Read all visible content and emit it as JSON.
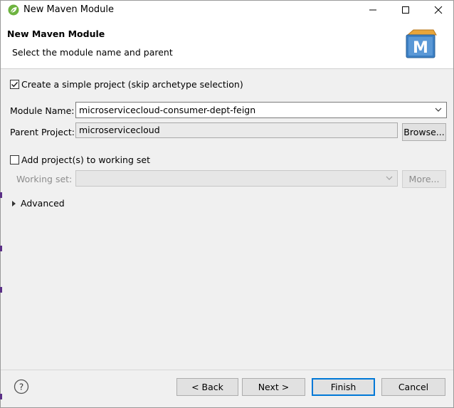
{
  "window": {
    "title": "New Maven Module",
    "minimize_icon": "minimize-icon",
    "maximize_icon": "maximize-icon",
    "close_icon": "close-icon"
  },
  "banner": {
    "title": "New Maven Module",
    "subtitle": "Select the module name and parent",
    "logo_letter": "M"
  },
  "form": {
    "simple_project": {
      "label": "Create a simple project (skip archetype selection)",
      "checked": true
    },
    "module_name": {
      "label": "Module Name:",
      "value": "microservicecloud-consumer-dept-feign"
    },
    "parent_project": {
      "label": "Parent Project:",
      "value": "microservicecloud",
      "browse_label": "Browse..."
    },
    "working_set_toggle": {
      "label": "Add project(s) to working set",
      "checked": false
    },
    "working_set": {
      "label": "Working set:",
      "value": "",
      "more_label": "More..."
    },
    "advanced": {
      "label": "Advanced"
    }
  },
  "footer": {
    "help_icon": "help-icon",
    "back_label": "< Back",
    "next_label": "Next >",
    "finish_label": "Finish",
    "cancel_label": "Cancel"
  },
  "colors": {
    "accent": "#0078d7",
    "logo_blue": "#3b7fc4",
    "logo_orange": "#e8a53a",
    "spring_green": "#6db33f"
  }
}
